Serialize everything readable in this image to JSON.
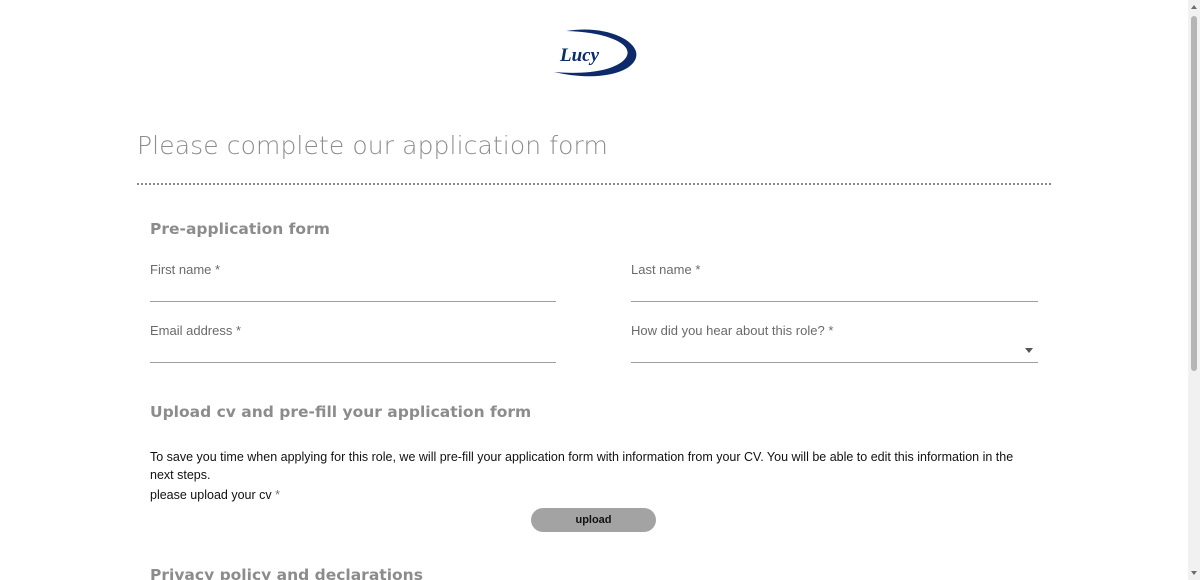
{
  "brand": {
    "logo_text": "Lucy",
    "color": "#0d2a6b"
  },
  "page": {
    "title": "Please complete our application form"
  },
  "pre_application": {
    "section_title": "Pre-application form",
    "fields": {
      "first_name": {
        "label": "First name",
        "required_mark": "*",
        "value": ""
      },
      "last_name": {
        "label": "Last name",
        "required_mark": "*",
        "value": ""
      },
      "email": {
        "label": "Email address",
        "required_mark": "*",
        "value": ""
      },
      "hear_about": {
        "label": "How did you hear about this role?",
        "required_mark": "*",
        "selected": "",
        "icon": "chevron-down-icon"
      }
    }
  },
  "upload_cv": {
    "section_title": "Upload cv and pre-fill your application form",
    "info": "To save you time when applying for this role, we will pre-fill your application form with information from your CV. You will be able to edit this information in the next steps.",
    "cv_label": "please upload your cv",
    "required_mark": "*",
    "button_label": "upload"
  },
  "privacy": {
    "section_title": "Privacy policy and declarations"
  },
  "colors": {
    "accent": "#0d2a6b",
    "muted_text": "#8c8c8c",
    "button_bg": "#a3a3a3"
  }
}
